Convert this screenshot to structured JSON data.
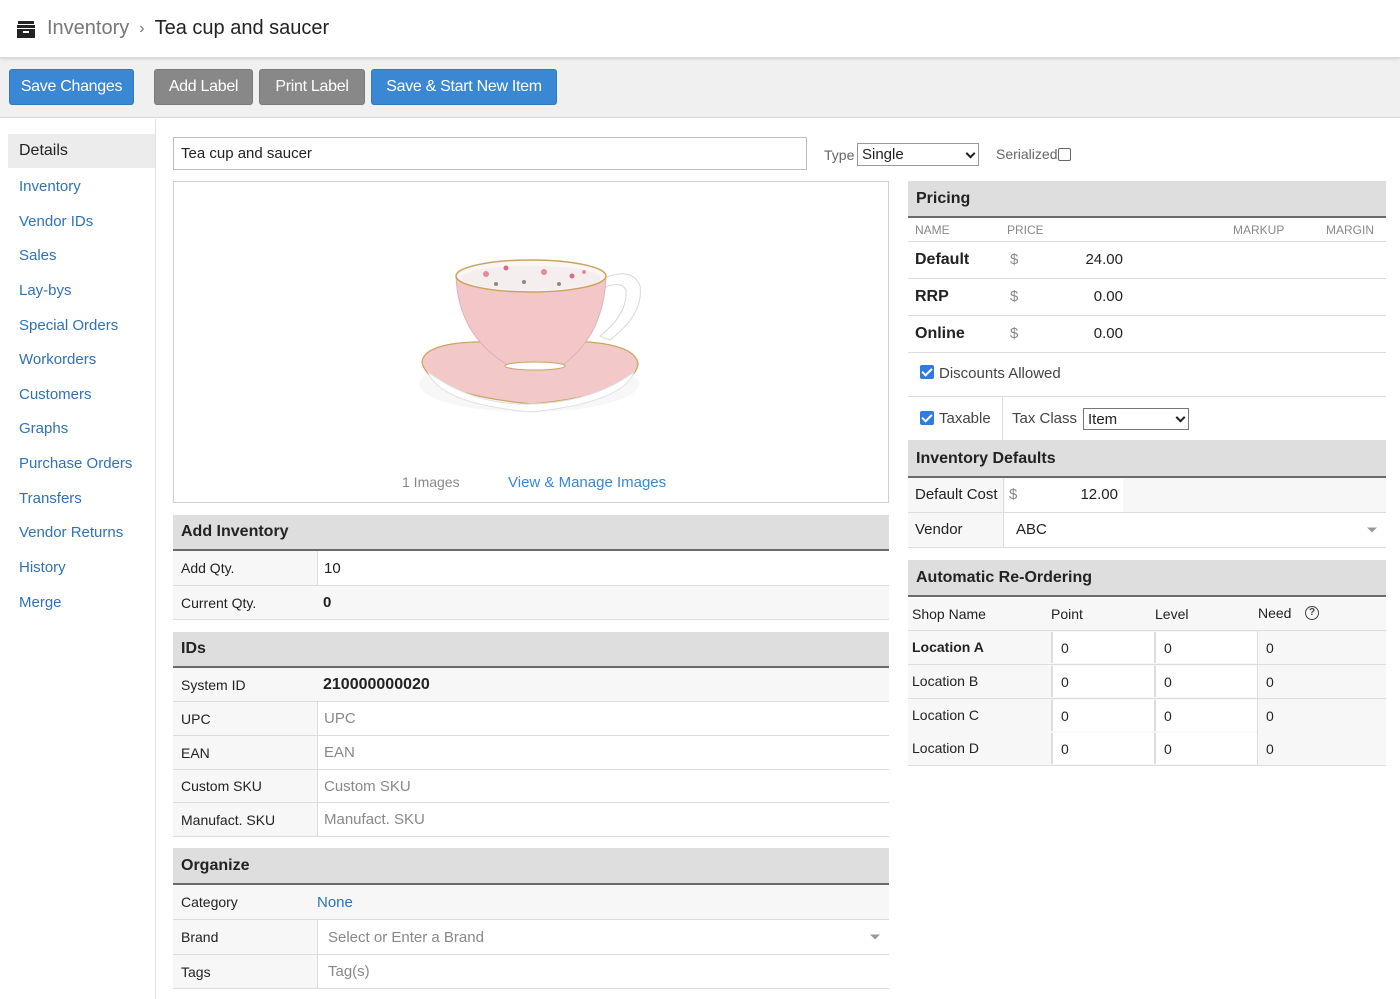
{
  "header": {
    "breadcrumb_root": "Inventory",
    "breadcrumb_separator": "›",
    "breadcrumb_current": "Tea cup and saucer",
    "icon": "inventory-box-icon"
  },
  "toolbar": {
    "save_changes": "Save Changes",
    "add_label": "Add Label",
    "print_label": "Print Label",
    "save_new": "Save & Start New Item"
  },
  "sidebar": {
    "items": [
      {
        "label": "Details",
        "active": true
      },
      {
        "label": "Inventory"
      },
      {
        "label": "Vendor IDs"
      },
      {
        "label": "Sales"
      },
      {
        "label": "Lay-bys"
      },
      {
        "label": "Special Orders"
      },
      {
        "label": "Workorders"
      },
      {
        "label": "Customers"
      },
      {
        "label": "Graphs"
      },
      {
        "label": "Purchase Orders"
      },
      {
        "label": "Transfers"
      },
      {
        "label": "Vendor Returns"
      },
      {
        "label": "History"
      },
      {
        "label": "Merge"
      }
    ]
  },
  "item": {
    "name": "Tea cup and saucer",
    "type_label": "Type",
    "type_value": "Single",
    "serialized_label": "Serialized",
    "serialized": false
  },
  "images": {
    "count_text": "1 Images",
    "manage_link": "View & Manage Images",
    "image_alt": "Pink tea cup and saucer with floral interior"
  },
  "add_inventory": {
    "title": "Add Inventory",
    "add_qty_label": "Add Qty.",
    "add_qty_value": "10",
    "current_qty_label": "Current Qty.",
    "current_qty_value": "0"
  },
  "ids": {
    "title": "IDs",
    "system_id_label": "System ID",
    "system_id_value": "210000000020",
    "upc_label": "UPC",
    "upc_placeholder": "UPC",
    "ean_label": "EAN",
    "ean_placeholder": "EAN",
    "custom_sku_label": "Custom SKU",
    "custom_sku_placeholder": "Custom SKU",
    "manufact_sku_label": "Manufact. SKU",
    "manufact_sku_placeholder": "Manufact. SKU"
  },
  "organize": {
    "title": "Organize",
    "category_label": "Category",
    "category_value": "None",
    "brand_label": "Brand",
    "brand_placeholder": "Select or Enter a Brand",
    "tags_label": "Tags",
    "tags_placeholder": "Tag(s)"
  },
  "pricing": {
    "title": "Pricing",
    "columns": {
      "name": "NAME",
      "price": "PRICE",
      "markup": "MARKUP",
      "margin": "MARGIN"
    },
    "currency": "$",
    "rows": [
      {
        "name": "Default",
        "price": "24.00"
      },
      {
        "name": "RRP",
        "price": "0.00"
      },
      {
        "name": "Online",
        "price": "0.00"
      }
    ],
    "discounts_label": "Discounts Allowed",
    "discounts_checked": true,
    "taxable_label": "Taxable",
    "taxable_checked": true,
    "tax_class_label": "Tax Class",
    "tax_class_value": "Item"
  },
  "inventory_defaults": {
    "title": "Inventory Defaults",
    "default_cost_label": "Default Cost",
    "currency": "$",
    "default_cost_value": "12.00",
    "vendor_label": "Vendor",
    "vendor_value": "ABC"
  },
  "reordering": {
    "title": "Automatic Re-Ordering",
    "columns": {
      "shop": "Shop Name",
      "point": "Point",
      "level": "Level",
      "need": "Need"
    },
    "rows": [
      {
        "shop": "Location A",
        "point": "0",
        "level": "0",
        "need": "0",
        "bold": true
      },
      {
        "shop": "Location B",
        "point": "0",
        "level": "0",
        "need": "0"
      },
      {
        "shop": "Location C",
        "point": "0",
        "level": "0",
        "need": "0"
      },
      {
        "shop": "Location D",
        "point": "0",
        "level": "0",
        "need": "0"
      }
    ]
  },
  "colors": {
    "primary_button": "#3a87d3",
    "secondary_button": "#888888",
    "link": "#2e72b8",
    "section_header_bg": "#dedede",
    "checkbox": "#2f7be0"
  }
}
